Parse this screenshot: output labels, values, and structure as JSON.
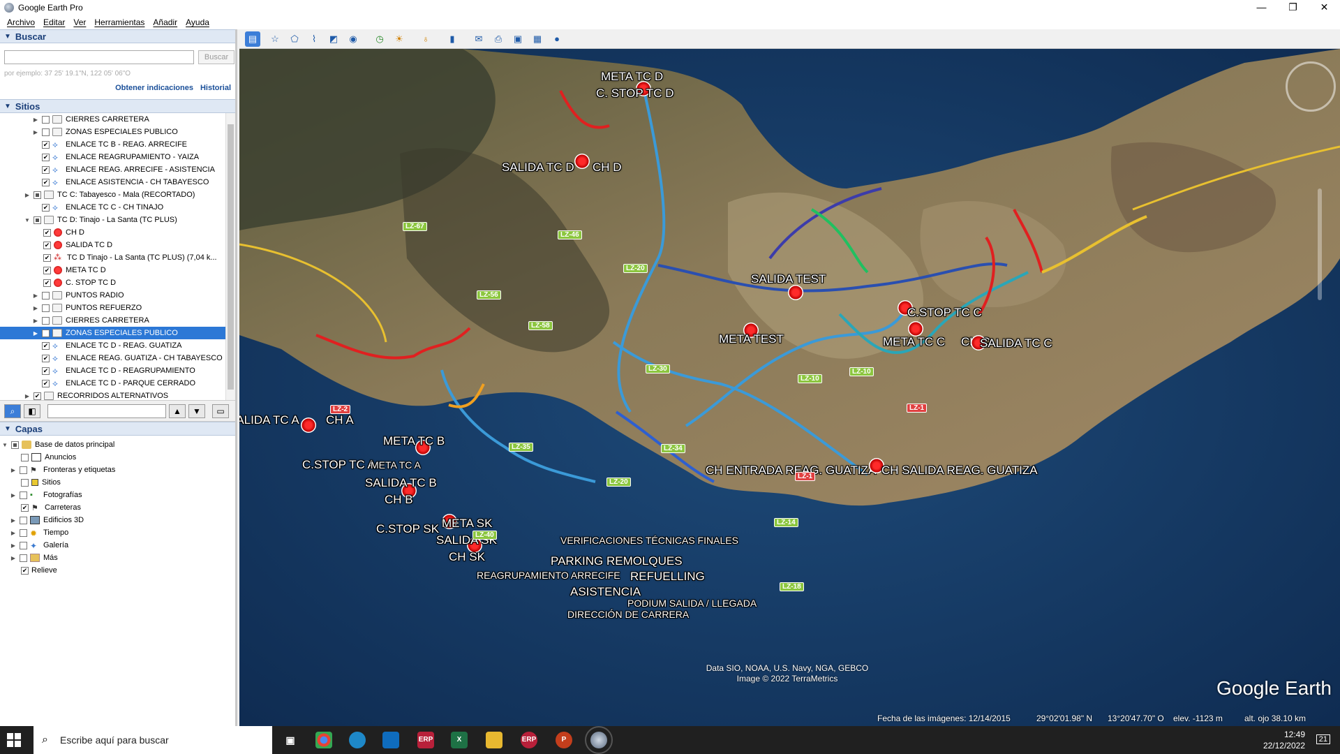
{
  "window": {
    "title": "Google Earth Pro",
    "minimize": "—",
    "maximize": "❐",
    "close": "✕"
  },
  "menu": [
    "Archivo",
    "Editar",
    "Ver",
    "Herramientas",
    "Añadir",
    "Ayuda"
  ],
  "search": {
    "header": "Buscar",
    "input_value": "",
    "button": "Buscar",
    "hint": "por ejemplo: 37 25' 19.1\"N, 122 05' 06\"O",
    "links": [
      "Obtener indicaciones",
      "Historial"
    ]
  },
  "places": {
    "header": "Sitios",
    "items": [
      {
        "label": "CIERRES CARRETERA"
      },
      {
        "label": "ZONAS ESPECIALES PUBLICO"
      },
      {
        "label": "ENLACE TC B - REAG. ARRECIFE"
      },
      {
        "label": "ENLACE REAGRUPAMIENTO - YAIZA"
      },
      {
        "label": "ENLACE REAG. ARRECIFE - ASISTENCIA"
      },
      {
        "label": "ENLACE ASISTENCIA - CH TABAYESCO"
      },
      {
        "label": "TC C: Tabayesco - Mala (RECORTADO)"
      },
      {
        "label": "ENLACE TC C - CH TINAJO"
      },
      {
        "label": "TC D: Tinajo - La Santa (TC PLUS)"
      },
      {
        "label": "CH D"
      },
      {
        "label": "SALIDA TC D"
      },
      {
        "label": "TC D Tinajo - La Santa (TC PLUS) (7,04 k..."
      },
      {
        "label": "META TC D"
      },
      {
        "label": "C. STOP TC D"
      },
      {
        "label": "PUNTOS RADIO"
      },
      {
        "label": "PUNTOS REFUERZO"
      },
      {
        "label": "CIERRES CARRETERA"
      },
      {
        "label": "ZONAS ESPECIALES PUBLICO"
      },
      {
        "label": "ENLACE TC D - REAG. GUATIZA"
      },
      {
        "label": "ENLACE REAG. GUATIZA - CH TABAYESCO"
      },
      {
        "label": "ENLACE TC D - REAGRUPAMIENTO"
      },
      {
        "label": "ENLACE TC D - PARQUE CERRADO"
      },
      {
        "label": "RECORRIDOS ALTERNATIVOS"
      }
    ]
  },
  "layers": {
    "header": "Capas",
    "items": [
      {
        "label": "Base de datos principal"
      },
      {
        "label": "Anuncios"
      },
      {
        "label": "Fronteras y etiquetas"
      },
      {
        "label": "Sitios"
      },
      {
        "label": "Fotografías"
      },
      {
        "label": "Carreteras"
      },
      {
        "label": "Edificios 3D"
      },
      {
        "label": "Tiempo"
      },
      {
        "label": "Galería"
      },
      {
        "label": "Más"
      },
      {
        "label": "Relieve"
      }
    ]
  },
  "map": {
    "labels": [
      {
        "text": "META TC D"
      },
      {
        "text": "C. STOP TC D"
      },
      {
        "text": "SALIDA TC D"
      },
      {
        "text": "CH D"
      },
      {
        "text": "SALIDA TEST"
      },
      {
        "text": "META TEST"
      },
      {
        "text": "C.STOP TC C"
      },
      {
        "text": "META TC C"
      },
      {
        "text": "CH C"
      },
      {
        "text": "SALIDA TC C"
      },
      {
        "text": "SALIDA TC A"
      },
      {
        "text": "CH A"
      },
      {
        "text": "META TC B"
      },
      {
        "text": "C.STOP TC A"
      },
      {
        "text": "META TC A"
      },
      {
        "text": "SALIDA TC B"
      },
      {
        "text": "CH B"
      },
      {
        "text": "META SK"
      },
      {
        "text": "C.STOP SK"
      },
      {
        "text": "SALIDA SK"
      },
      {
        "text": "CH SK"
      },
      {
        "text": "VERIFICACIONES TÉCNICAS FINALES"
      },
      {
        "text": "PARKING REMOLQUES"
      },
      {
        "text": "REAGRUPAMIENTO ARRECIFE"
      },
      {
        "text": "REFUELLING"
      },
      {
        "text": "ASISTENCIA"
      },
      {
        "text": "PODIUM SALIDA / LLEGADA"
      },
      {
        "text": "DIRECCIÓN DE CARRERA"
      },
      {
        "text": "CH ENTRADA REAG. GUATIZA"
      },
      {
        "text": "CH SALIDA REAG. GUATIZA"
      }
    ],
    "roads": [
      "LZ-67",
      "LZ-46",
      "LZ-20",
      "LZ-56",
      "LZ-58",
      "LZ-30",
      "LZ-10",
      "LZ-10",
      "LZ-1",
      "LZ-2",
      "LZ-35",
      "LZ-34",
      "LZ-20",
      "LZ-14",
      "LZ-18",
      "LZ-1",
      "LZ-40"
    ],
    "credits": [
      "Data SIO, NOAA, U.S. Navy, NGA, GEBCO",
      "Image © 2022 TerraMetrics"
    ],
    "logo": "Google Earth",
    "status": {
      "imagery_date": "Fecha de las imágenes: 12/14/2015",
      "lat": "29°02'01.98\" N",
      "lon": "13°20'47.70\" O",
      "elev": "elev. -1123 m",
      "eye": "alt. ojo  38.10 km"
    }
  },
  "taskbar": {
    "search_placeholder": "Escribe aquí para buscar",
    "apps": [
      "ERP",
      "X",
      "ERP",
      "P"
    ],
    "time": "12:49",
    "date": "22/12/2022",
    "notifications": "21"
  }
}
